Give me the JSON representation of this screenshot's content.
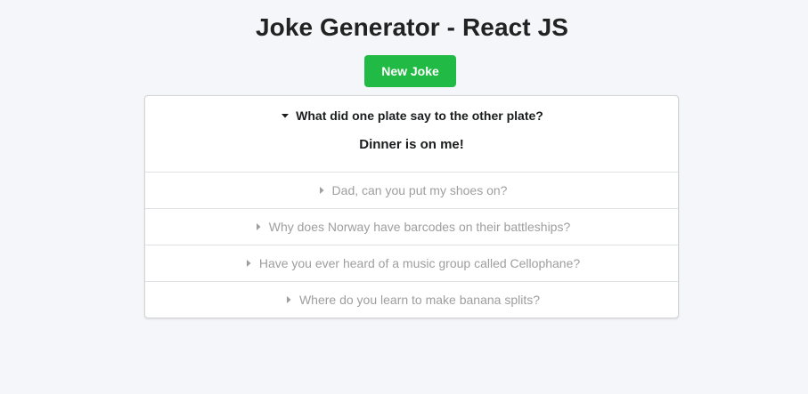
{
  "header": {
    "title": "Joke Generator - React JS"
  },
  "toolbar": {
    "new_joke_label": "New Joke"
  },
  "jokes": [
    {
      "question": "What did one plate say to the other plate?",
      "answer": "Dinner is on me!",
      "expanded": true
    },
    {
      "question": "Dad, can you put my shoes on?",
      "expanded": false
    },
    {
      "question": "Why does Norway have barcodes on their battleships?",
      "expanded": false
    },
    {
      "question": "Have you ever heard of a music group called Cellophane?",
      "expanded": false
    },
    {
      "question": "Where do you learn to make banana splits?",
      "expanded": false
    }
  ],
  "colors": {
    "background": "#f4f6fa",
    "button": "#21ba45",
    "active_text": "#1b1c1d",
    "inactive_text": "#9e9e9e"
  },
  "icons": {
    "expanded": "caret-down-icon",
    "collapsed": "caret-right-icon"
  }
}
